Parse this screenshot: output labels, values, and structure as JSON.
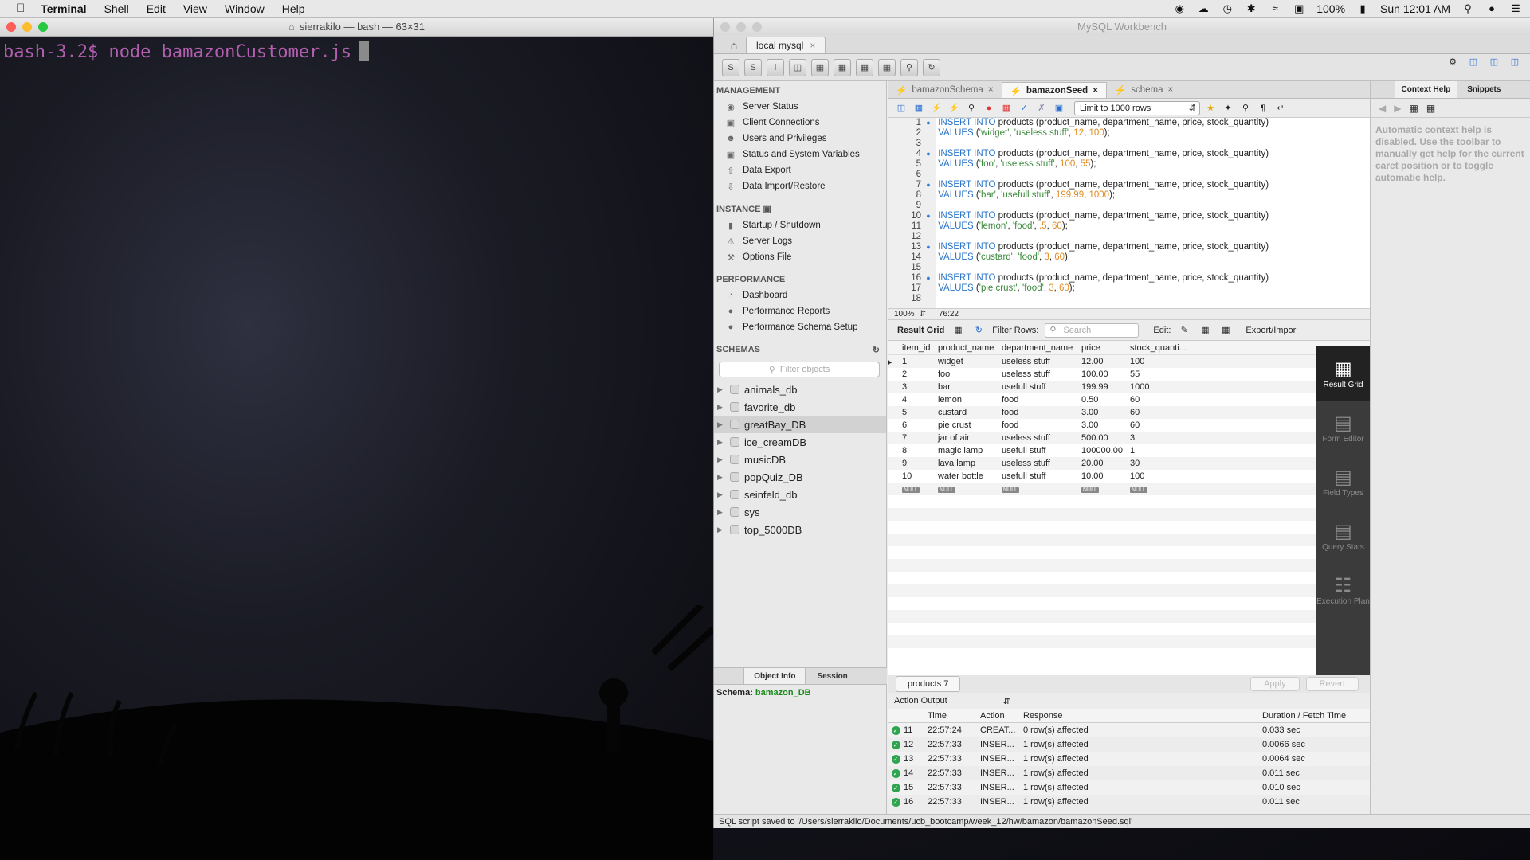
{
  "menubar": {
    "apple": "",
    "items": [
      "Terminal",
      "Shell",
      "Edit",
      "View",
      "Window",
      "Help"
    ],
    "battery": "100%",
    "clock": "Sun 12:01 AM"
  },
  "terminal": {
    "title": "sierrakilo — bash — 63×31",
    "prompt": "bash-3.2$ node bamazonCustomer.js"
  },
  "workbench": {
    "title": "MySQL Workbench",
    "connection_tab": "local mysql",
    "navigator": {
      "management_header": "MANAGEMENT",
      "management": [
        "Server Status",
        "Client Connections",
        "Users and Privileges",
        "Status and System Variables",
        "Data Export",
        "Data Import/Restore"
      ],
      "instance_header": "INSTANCE",
      "instance": [
        "Startup / Shutdown",
        "Server Logs",
        "Options File"
      ],
      "performance_header": "PERFORMANCE",
      "performance": [
        "Dashboard",
        "Performance Reports",
        "Performance Schema Setup"
      ],
      "schemas_header": "SCHEMAS",
      "filter_placeholder": "Filter objects",
      "schemas": [
        "animals_db",
        "favorite_db",
        "greatBay_DB",
        "ice_creamDB",
        "musicDB",
        "popQuiz_DB",
        "seinfeld_db",
        "sys",
        "top_5000DB"
      ],
      "bottom_tabs": [
        "Object Info",
        "Session"
      ],
      "schema_label": "Schema:",
      "schema_value": "bamazon_DB"
    },
    "editor": {
      "tabs": [
        "bamazonSchema",
        "bamazonSeed",
        "schema"
      ],
      "limit": "Limit to 1000 rows",
      "zoom": "100%",
      "cursor_pos": "76:22",
      "lines": [
        {
          "n": "1",
          "insert": "INSERT INTO",
          "rest": " products (product_name, department_name, price, stock_quantity)"
        },
        {
          "n": "2",
          "values": "VALUES",
          "a": "'widget'",
          "b": "'useless stuff'",
          "c": "12",
          "d": "100"
        },
        {
          "n": "3"
        },
        {
          "n": "4",
          "insert": "INSERT INTO",
          "rest": " products (product_name, department_name, price, stock_quantity)"
        },
        {
          "n": "5",
          "values": "VALUES",
          "a": "'foo'",
          "b": "'useless stuff'",
          "c": "100",
          "d": "55"
        },
        {
          "n": "6"
        },
        {
          "n": "7",
          "insert": "INSERT INTO",
          "rest": " products (product_name, department_name, price, stock_quantity)"
        },
        {
          "n": "8",
          "values": "VALUES",
          "a": "'bar'",
          "b": "'usefull stuff'",
          "c": "199.99",
          "d": "1000"
        },
        {
          "n": "9"
        },
        {
          "n": "10",
          "insert": "INSERT INTO",
          "rest": " products (product_name, department_name, price, stock_quantity)"
        },
        {
          "n": "11",
          "values": "VALUES",
          "a": "'lemon'",
          "b": "'food'",
          "c": ".5",
          "d": "60"
        },
        {
          "n": "12"
        },
        {
          "n": "13",
          "insert": "INSERT INTO",
          "rest": " products (product_name, department_name, price, stock_quantity)"
        },
        {
          "n": "14",
          "values": "VALUES",
          "a": "'custard'",
          "b": "'food'",
          "c": "3",
          "d": "60"
        },
        {
          "n": "15"
        },
        {
          "n": "16",
          "insert": "INSERT INTO",
          "rest": " products (product_name, department_name, price, stock_quantity)"
        },
        {
          "n": "17",
          "values": "VALUES",
          "a": "'pie crust'",
          "b": "'food'",
          "c": "3",
          "d": "60"
        },
        {
          "n": "18"
        }
      ]
    },
    "result": {
      "label": "Result Grid",
      "filter_label": "Filter Rows:",
      "search_placeholder": "Search",
      "edit_label": "Edit:",
      "export_label": "Export/Impor",
      "columns": [
        "item_id",
        "product_name",
        "department_name",
        "price",
        "stock_quanti..."
      ],
      "rows": [
        [
          "1",
          "widget",
          "useless stuff",
          "12.00",
          "100"
        ],
        [
          "2",
          "foo",
          "useless stuff",
          "100.00",
          "55"
        ],
        [
          "3",
          "bar",
          "usefull stuff",
          "199.99",
          "1000"
        ],
        [
          "4",
          "lemon",
          "food",
          "0.50",
          "60"
        ],
        [
          "5",
          "custard",
          "food",
          "3.00",
          "60"
        ],
        [
          "6",
          "pie crust",
          "food",
          "3.00",
          "60"
        ],
        [
          "7",
          "jar of air",
          "useless stuff",
          "500.00",
          "3"
        ],
        [
          "8",
          "magic lamp",
          "usefull stuff",
          "100000.00",
          "1"
        ],
        [
          "9",
          "lava lamp",
          "useless stuff",
          "20.00",
          "30"
        ],
        [
          "10",
          "water bottle",
          "usefull stuff",
          "10.00",
          "100"
        ]
      ],
      "null_label": "NULL",
      "side_buttons": [
        "Result Grid",
        "Form Editor",
        "Field Types",
        "Query Stats",
        "Execution Plan"
      ],
      "result_tab": "products 7",
      "apply": "Apply",
      "revert": "Revert"
    },
    "output": {
      "label": "Action Output",
      "columns": [
        "",
        "Time",
        "Action",
        "Response",
        "Duration / Fetch Time"
      ],
      "rows": [
        [
          "11",
          "22:57:24",
          "CREAT...",
          "0 row(s) affected",
          "0.033 sec"
        ],
        [
          "12",
          "22:57:33",
          "INSER...",
          "1 row(s) affected",
          "0.0066 sec"
        ],
        [
          "13",
          "22:57:33",
          "INSER...",
          "1 row(s) affected",
          "0.0064 sec"
        ],
        [
          "14",
          "22:57:33",
          "INSER...",
          "1 row(s) affected",
          "0.011 sec"
        ],
        [
          "15",
          "22:57:33",
          "INSER...",
          "1 row(s) affected",
          "0.010 sec"
        ],
        [
          "16",
          "22:57:33",
          "INSER...",
          "1 row(s) affected",
          "0.011 sec"
        ]
      ]
    },
    "context": {
      "tabs": [
        "Context Help",
        "Snippets"
      ],
      "text": "Automatic context help is disabled. Use the toolbar to manually get help for the current caret position or to toggle automatic help."
    },
    "status": "SQL script saved to '/Users/sierrakilo/Documents/ucb_bootcamp/week_12/hw/bamazon/bamazonSeed.sql'"
  }
}
